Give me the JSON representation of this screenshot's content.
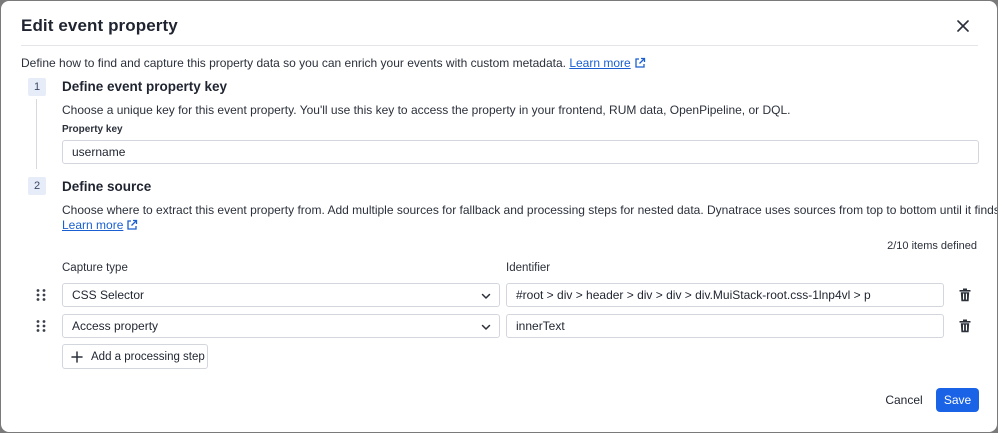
{
  "dialog": {
    "title": "Edit event property",
    "intro_text": "Define how to find and capture this property data so you can enrich your events with custom metadata.",
    "intro_link": "Learn more"
  },
  "step1": {
    "number": "1",
    "title": "Define event property key",
    "description": "Choose a unique key for this event property. You'll use this key to access the property in your frontend, RUM data, OpenPipeline, or DQL.",
    "field_label": "Property key",
    "field_value": "username"
  },
  "step2": {
    "number": "2",
    "title": "Define source",
    "description": "Choose where to extract this event property from. Add multiple sources for fallback and processing steps for nested data. Dynatrace uses sources from top to bottom until it finds a value.",
    "link": "Learn more",
    "items_defined": "2/10 items defined",
    "col_capture_type": "Capture type",
    "col_identifier": "Identifier",
    "rows": [
      {
        "capture_type": "CSS Selector",
        "identifier": "#root > div > header > div > div > div.MuiStack-root.css-1lnp4vl > p"
      },
      {
        "capture_type": "Access property",
        "identifier": "innerText"
      }
    ],
    "add_step_label": "Add a processing step"
  },
  "footer": {
    "cancel_label": "Cancel",
    "save_label": "Save"
  },
  "colors": {
    "accent": "#1a63e6",
    "link": "#1a5fd1"
  },
  "icons": {
    "close": "close-icon",
    "external": "external-link-icon",
    "drag": "drag-handle-icon",
    "chevron": "chevron-down-icon",
    "trash": "trash-icon",
    "plus": "plus-icon"
  }
}
